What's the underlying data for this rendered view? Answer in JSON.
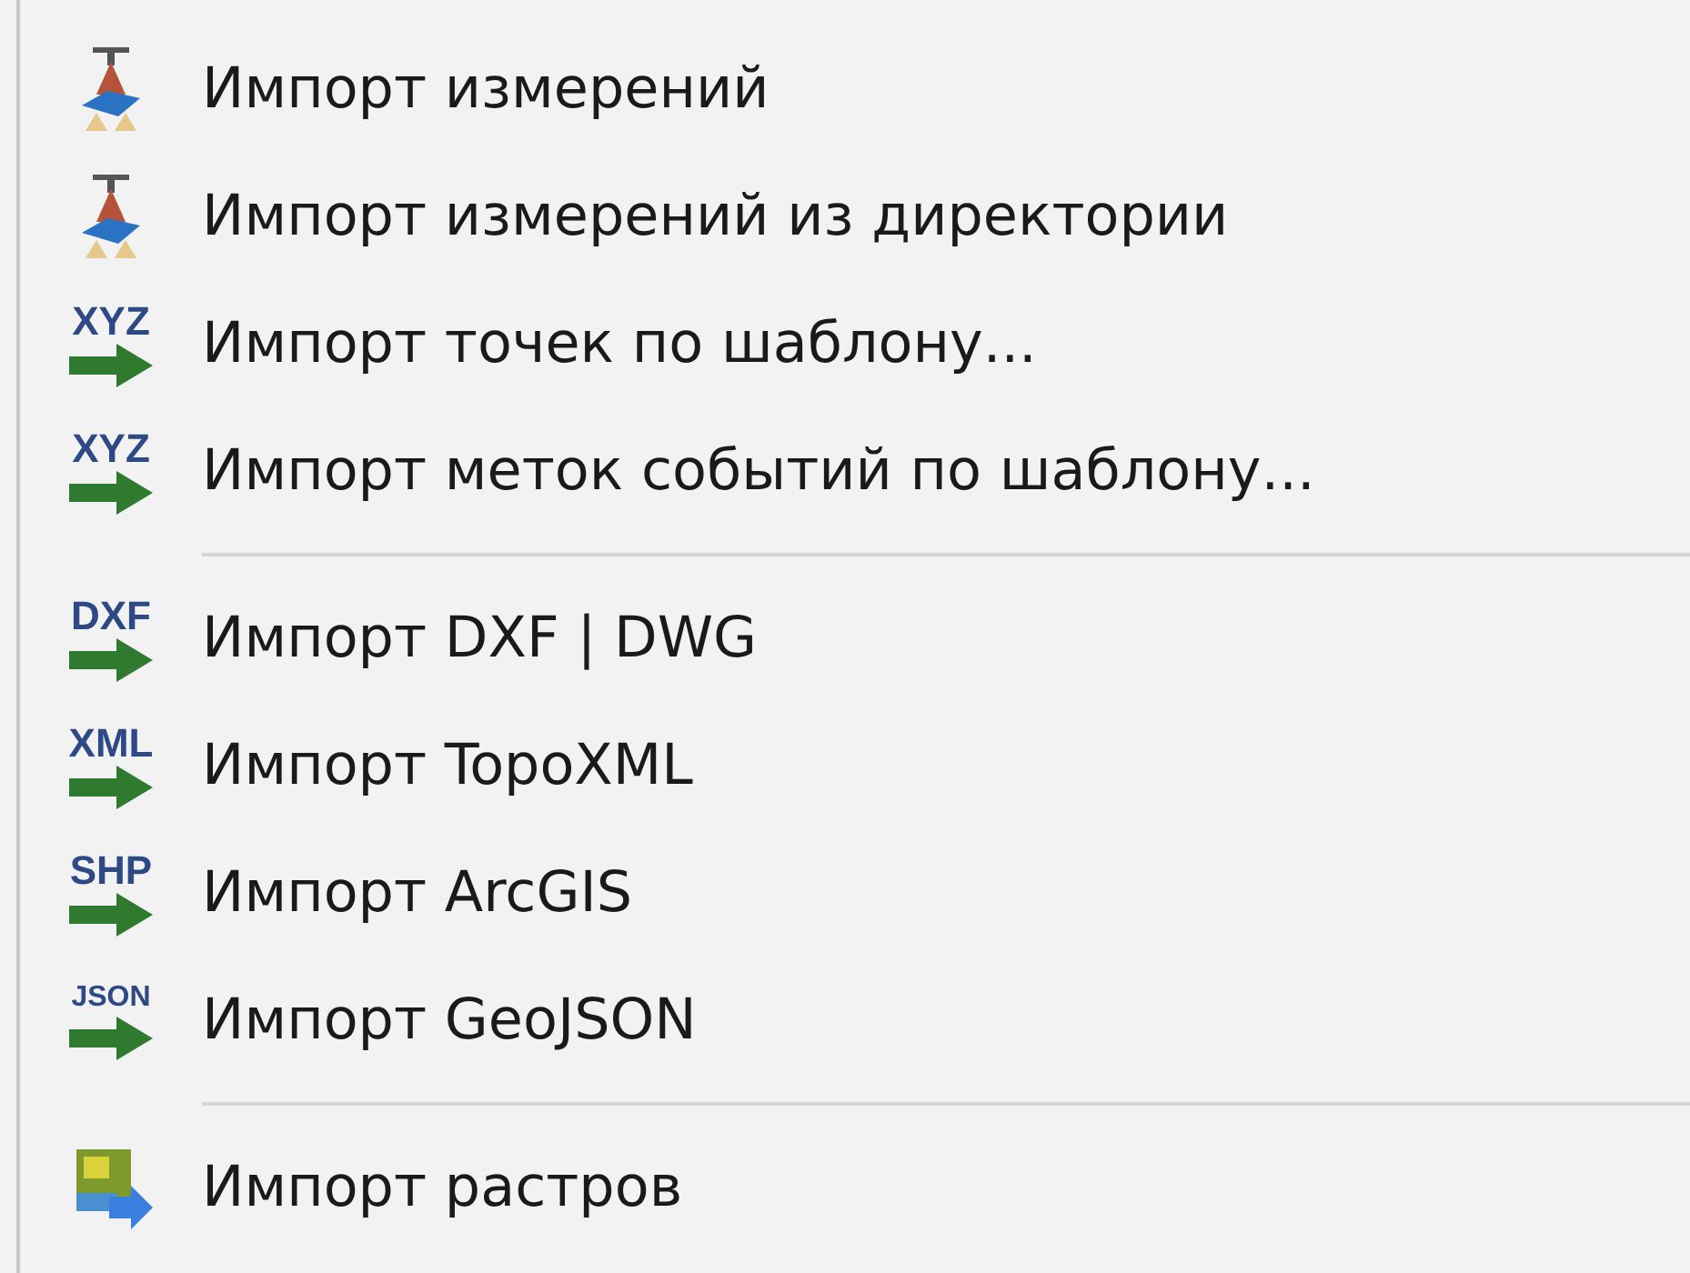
{
  "menu": {
    "items": [
      {
        "kind": "survey",
        "label": "Импорт измерений"
      },
      {
        "kind": "survey",
        "label": "Импорт измерений из директории"
      },
      {
        "kind": "format",
        "badge": "XYZ",
        "label": "Импорт точек по шаблону..."
      },
      {
        "kind": "format",
        "badge": "XYZ",
        "label": "Импорт меток событий по шаблону..."
      },
      {
        "kind": "separator"
      },
      {
        "kind": "format",
        "badge": "DXF",
        "label": "Импорт DXF | DWG"
      },
      {
        "kind": "format",
        "badge": "XML",
        "label": "Импорт TopoXML"
      },
      {
        "kind": "format",
        "badge": "SHP",
        "label": "Импорт ArcGIS"
      },
      {
        "kind": "format",
        "badge": "JSON",
        "label": "Импорт GeoJSON"
      },
      {
        "kind": "separator"
      },
      {
        "kind": "raster",
        "label": "Импорт растров"
      }
    ]
  }
}
